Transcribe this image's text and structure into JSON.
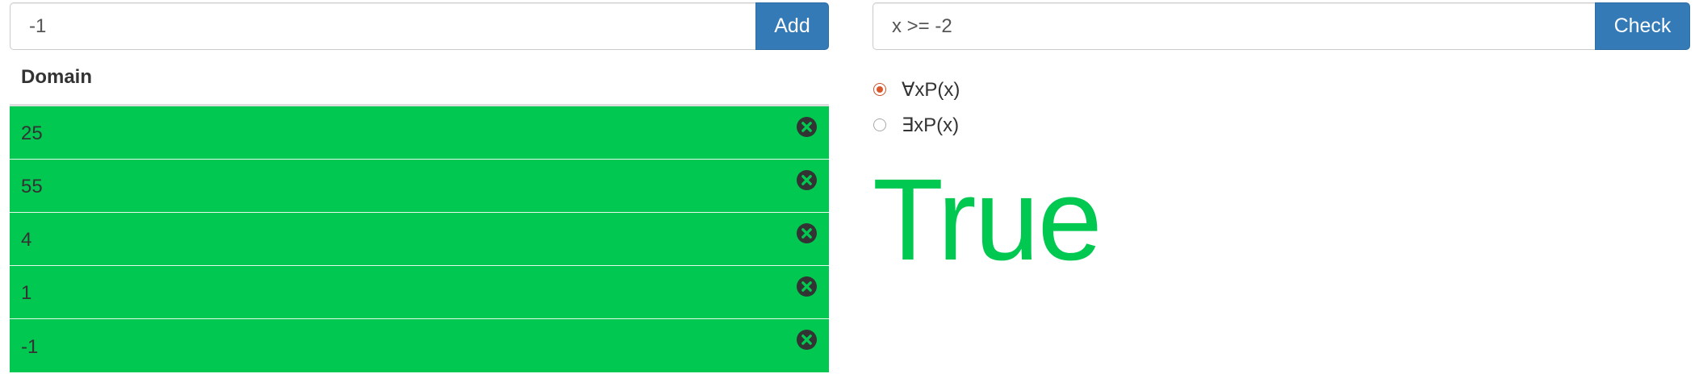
{
  "add_form": {
    "input_value": "-1",
    "button_label": "Add"
  },
  "domain": {
    "header": "Domain",
    "items": [
      {
        "value": "25"
      },
      {
        "value": "55"
      },
      {
        "value": "4"
      },
      {
        "value": "1"
      },
      {
        "value": "-1"
      }
    ],
    "row_color": "#00c851"
  },
  "check_form": {
    "input_value": "x >= -2",
    "button_label": "Check"
  },
  "quantifiers": [
    {
      "label": "∀xP(x)",
      "selected": true
    },
    {
      "label": "∃xP(x)",
      "selected": false
    }
  ],
  "result": {
    "text": "True",
    "color": "#00c851"
  },
  "colors": {
    "primary_button": "#337ab7",
    "radio_checked": "#d9582b"
  }
}
